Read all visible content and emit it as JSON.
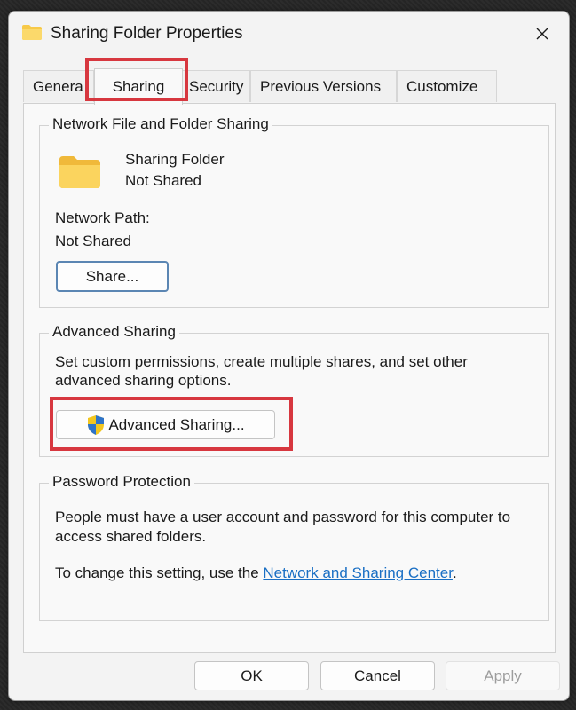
{
  "window": {
    "title": "Sharing Folder Properties"
  },
  "tabs": [
    {
      "label": "General",
      "display": "Genera"
    },
    {
      "label": "Sharing"
    },
    {
      "label": "Security"
    },
    {
      "label": "Previous Versions"
    },
    {
      "label": "Customize"
    }
  ],
  "network_sharing": {
    "group_label": "Network File and Folder Sharing",
    "folder_name": "Sharing Folder",
    "folder_status": "Not Shared",
    "network_path_label": "Network Path:",
    "network_path_value": "Not Shared",
    "share_button": "Share..."
  },
  "advanced_sharing": {
    "group_label": "Advanced Sharing",
    "description_line1": "Set custom permissions, create multiple shares, and set other",
    "description_line2": "advanced sharing options.",
    "button_label": "Advanced Sharing..."
  },
  "password_protection": {
    "group_label": "Password Protection",
    "text_line1": "People must have a user account and password for this computer to",
    "text_line2": "access shared folders.",
    "change_text": "To change this setting, use the ",
    "link_text": "Network and Sharing Center",
    "after_link": "."
  },
  "footer": {
    "ok": "OK",
    "cancel": "Cancel",
    "apply": "Apply"
  },
  "colors": {
    "highlight": "#d7373f",
    "link": "#1a6fc4",
    "folder": "#f7c948"
  },
  "icons": {
    "folder": "folder-icon",
    "shield": "uac-shield-icon",
    "close": "close-icon"
  }
}
